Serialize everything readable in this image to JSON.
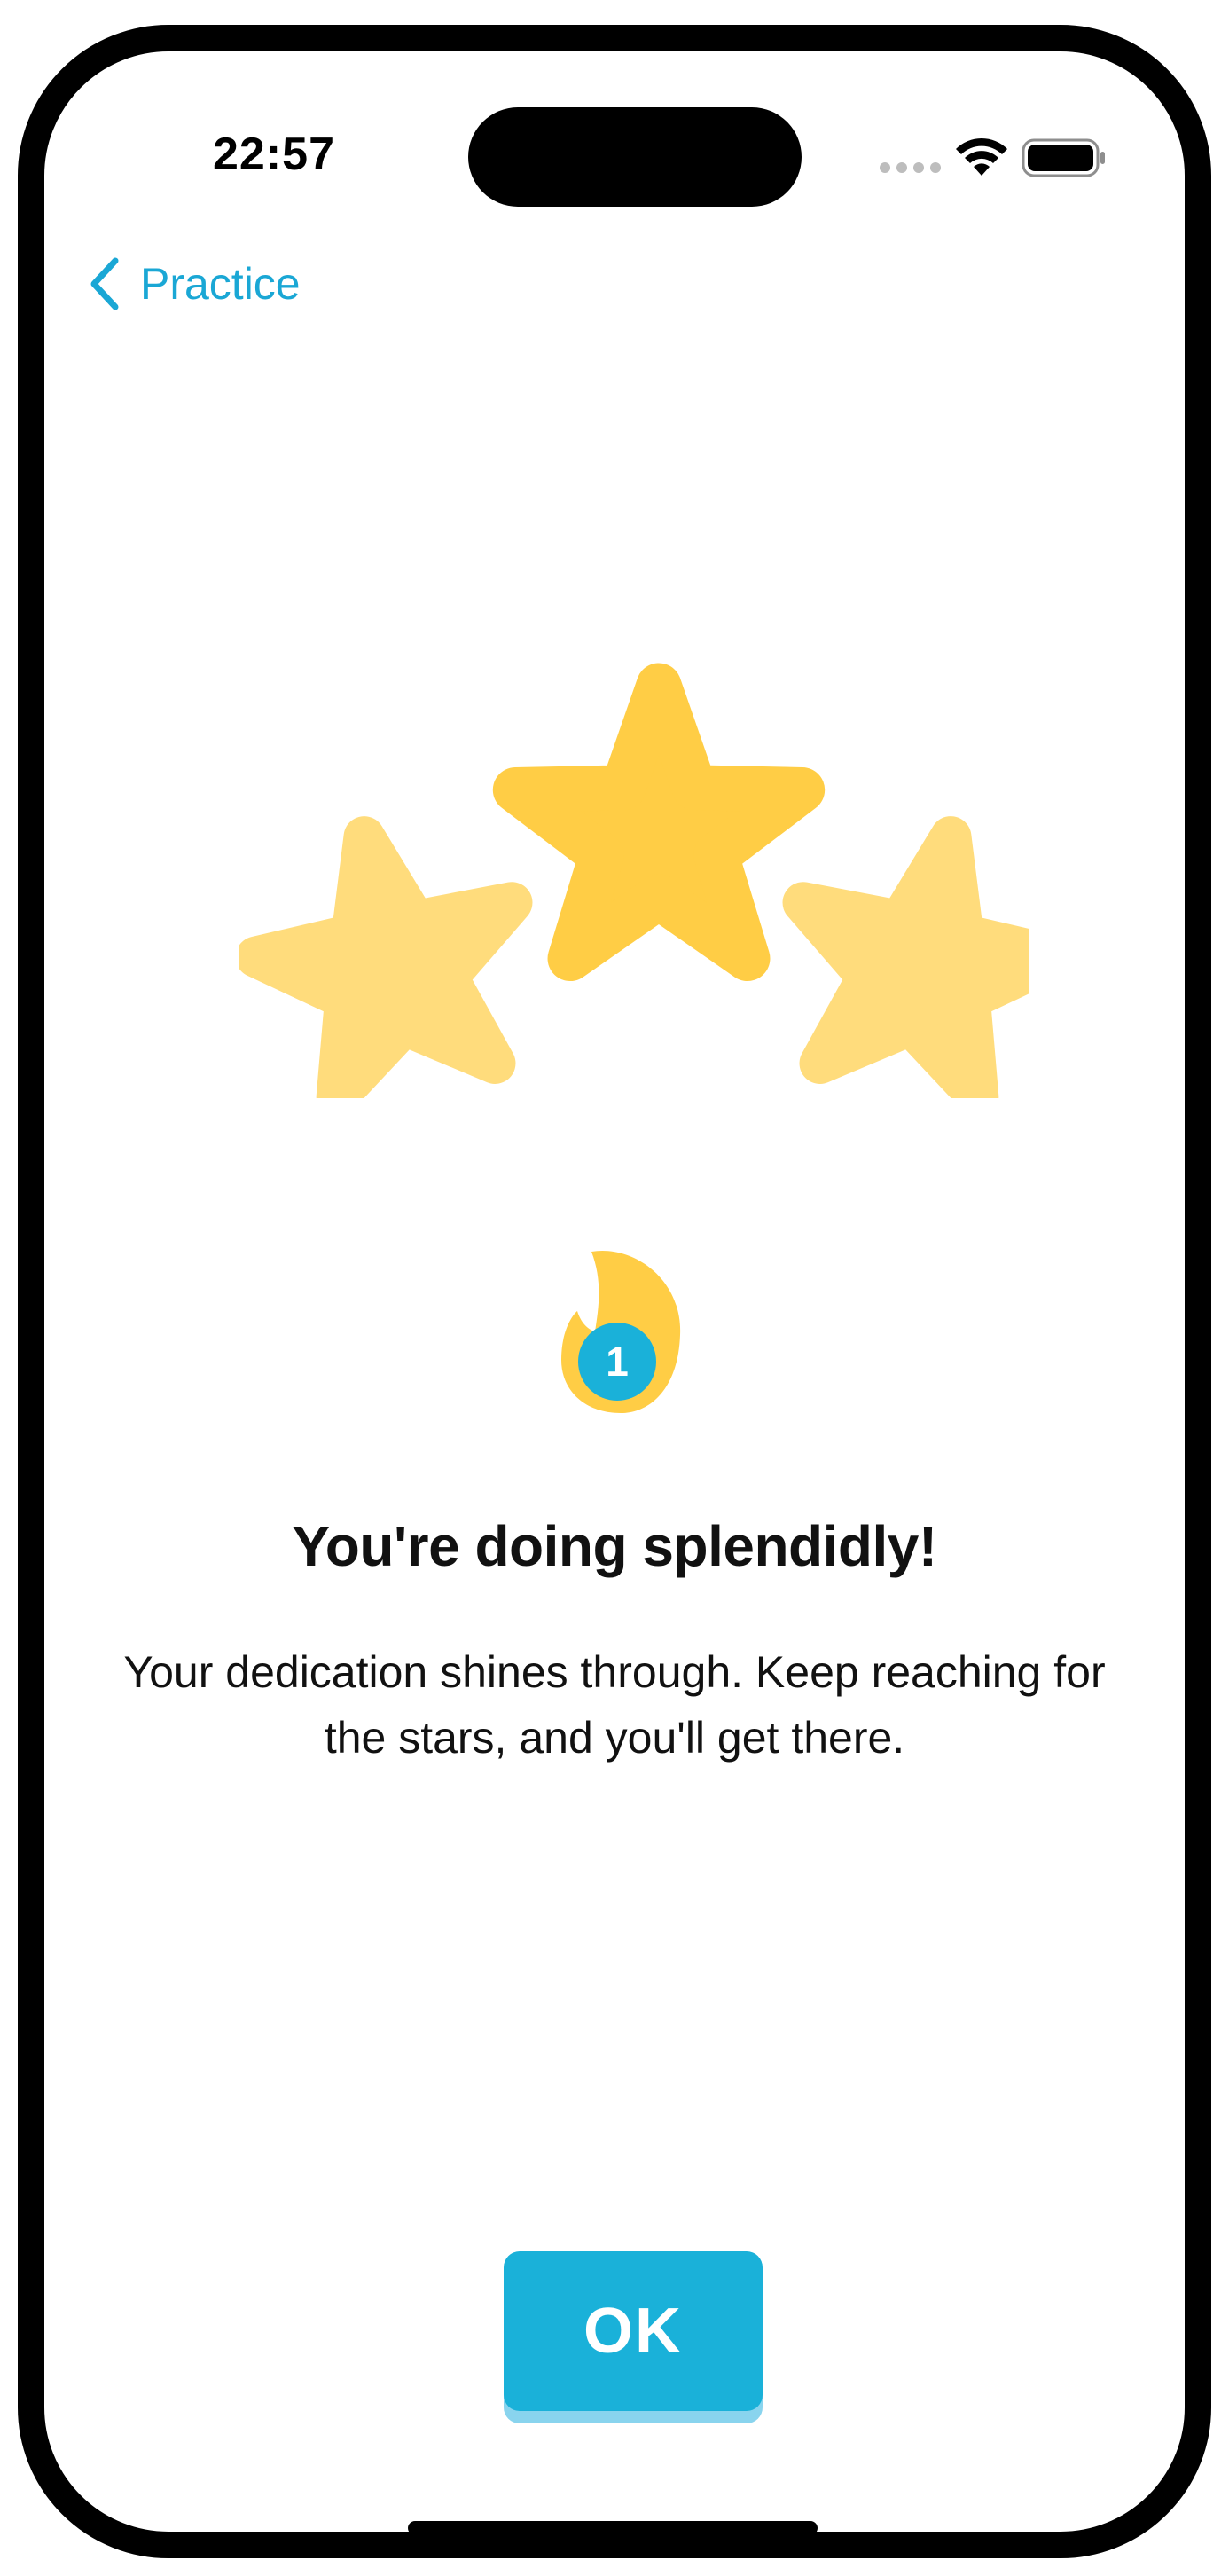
{
  "status_bar": {
    "time": "22:57",
    "icons": [
      "cellular-signal-icon",
      "wifi-icon",
      "battery-icon"
    ]
  },
  "nav": {
    "back_label": "Practice",
    "back_icon": "chevron-left-icon"
  },
  "result": {
    "stars_earned": 3,
    "stars_total": 3,
    "streak_count": "1",
    "headline": "You're doing splendidly!",
    "message": "Your dedication shines through. Keep reaching for the stars, and you'll get there."
  },
  "actions": {
    "ok_label": "OK"
  },
  "colors": {
    "accent": "#1ab1d9",
    "star_primary": "#ffcd45",
    "star_secondary": "#ffdc7c",
    "flame": "#ffcd45"
  }
}
